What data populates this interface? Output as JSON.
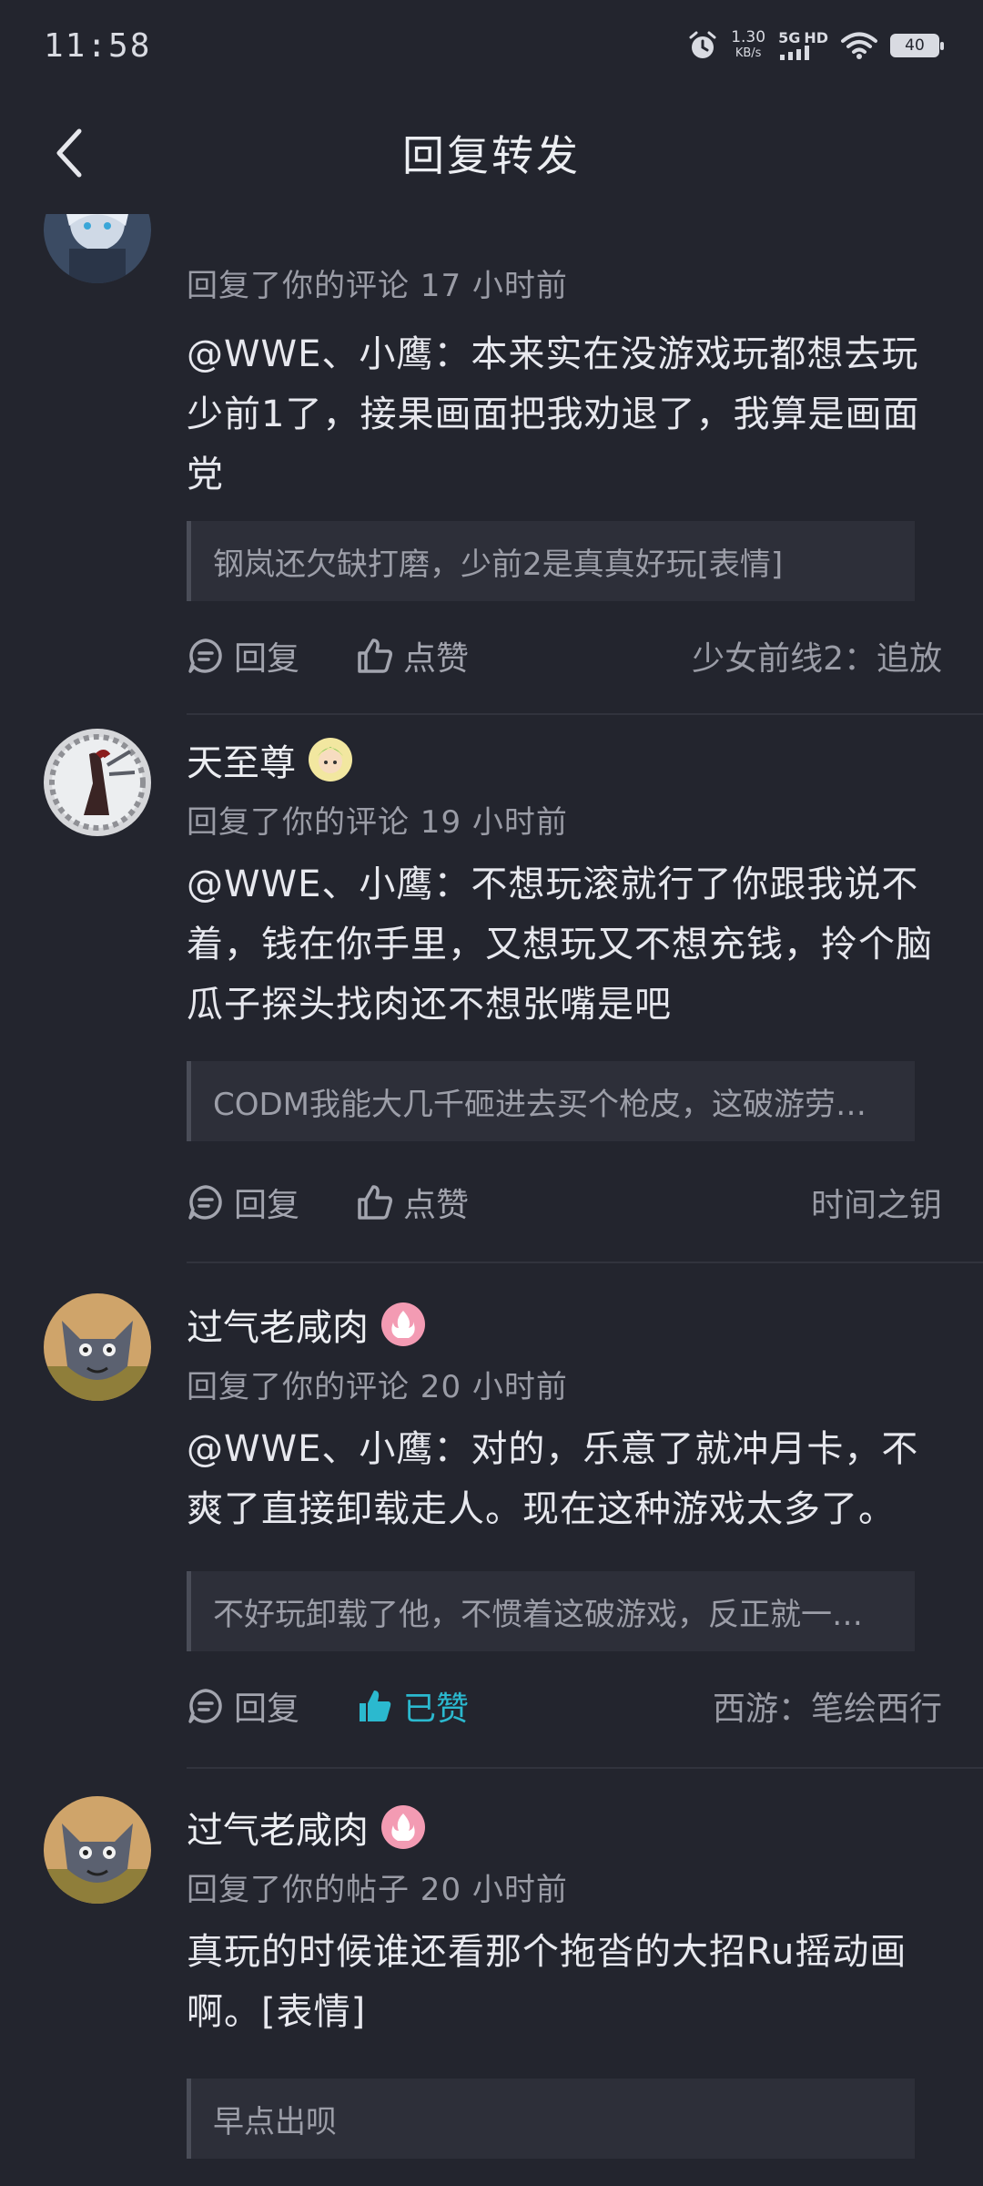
{
  "status_bar": {
    "time": "11:58",
    "net_speed": "1.30",
    "net_unit": "KB/s",
    "network_5g": "5G",
    "network_hd": "HD",
    "battery": "40"
  },
  "header": {
    "title": "回复转发"
  },
  "comments": [
    {
      "username": "",
      "meta": "回复了你的评论 17 小时前",
      "body": "@WWE、小鹰：本来实在没游戏玩都想去玩少前1了，接果画面把我劝退了，我算是画面党",
      "quote": "钢岚还欠缺打磨，少前2是真真好玩[表情]",
      "reply_label": "回复",
      "like_label": "点赞",
      "source": "少女前线2：追放"
    },
    {
      "username": "天至尊",
      "meta": "回复了你的评论 19 小时前",
      "body": "@WWE、小鹰：不想玩滚就行了你跟我说不着，钱在你手里，又想玩又不想充钱，拎个脑瓜子探头找肉还不想张嘴是吧",
      "quote": "CODM我能大几千砸进去买个枪皮，这破游劳…",
      "reply_label": "回复",
      "like_label": "点赞",
      "source": "时间之钥"
    },
    {
      "username": "过气老咸肉",
      "meta": "回复了你的评论 20 小时前",
      "body": "@WWE、小鹰：对的，乐意了就冲月卡，不爽了直接卸载走人。现在这种游戏太多了。",
      "quote": "不好玩卸载了他，不惯着这破游戏，反正就一…",
      "reply_label": "回复",
      "like_label": "已赞",
      "source": "西游：笔绘西行"
    },
    {
      "username": "过气老咸肉",
      "meta": "回复了你的帖子 20 小时前",
      "body": "真玩的时候谁还看那个拖沓的大招Ru摇动画啊。[表情]",
      "quote": "早点出呗"
    }
  ],
  "colors": {
    "background": "#23252e",
    "liked": "#2bb9cf",
    "badge_pink": "#f39bb3"
  }
}
